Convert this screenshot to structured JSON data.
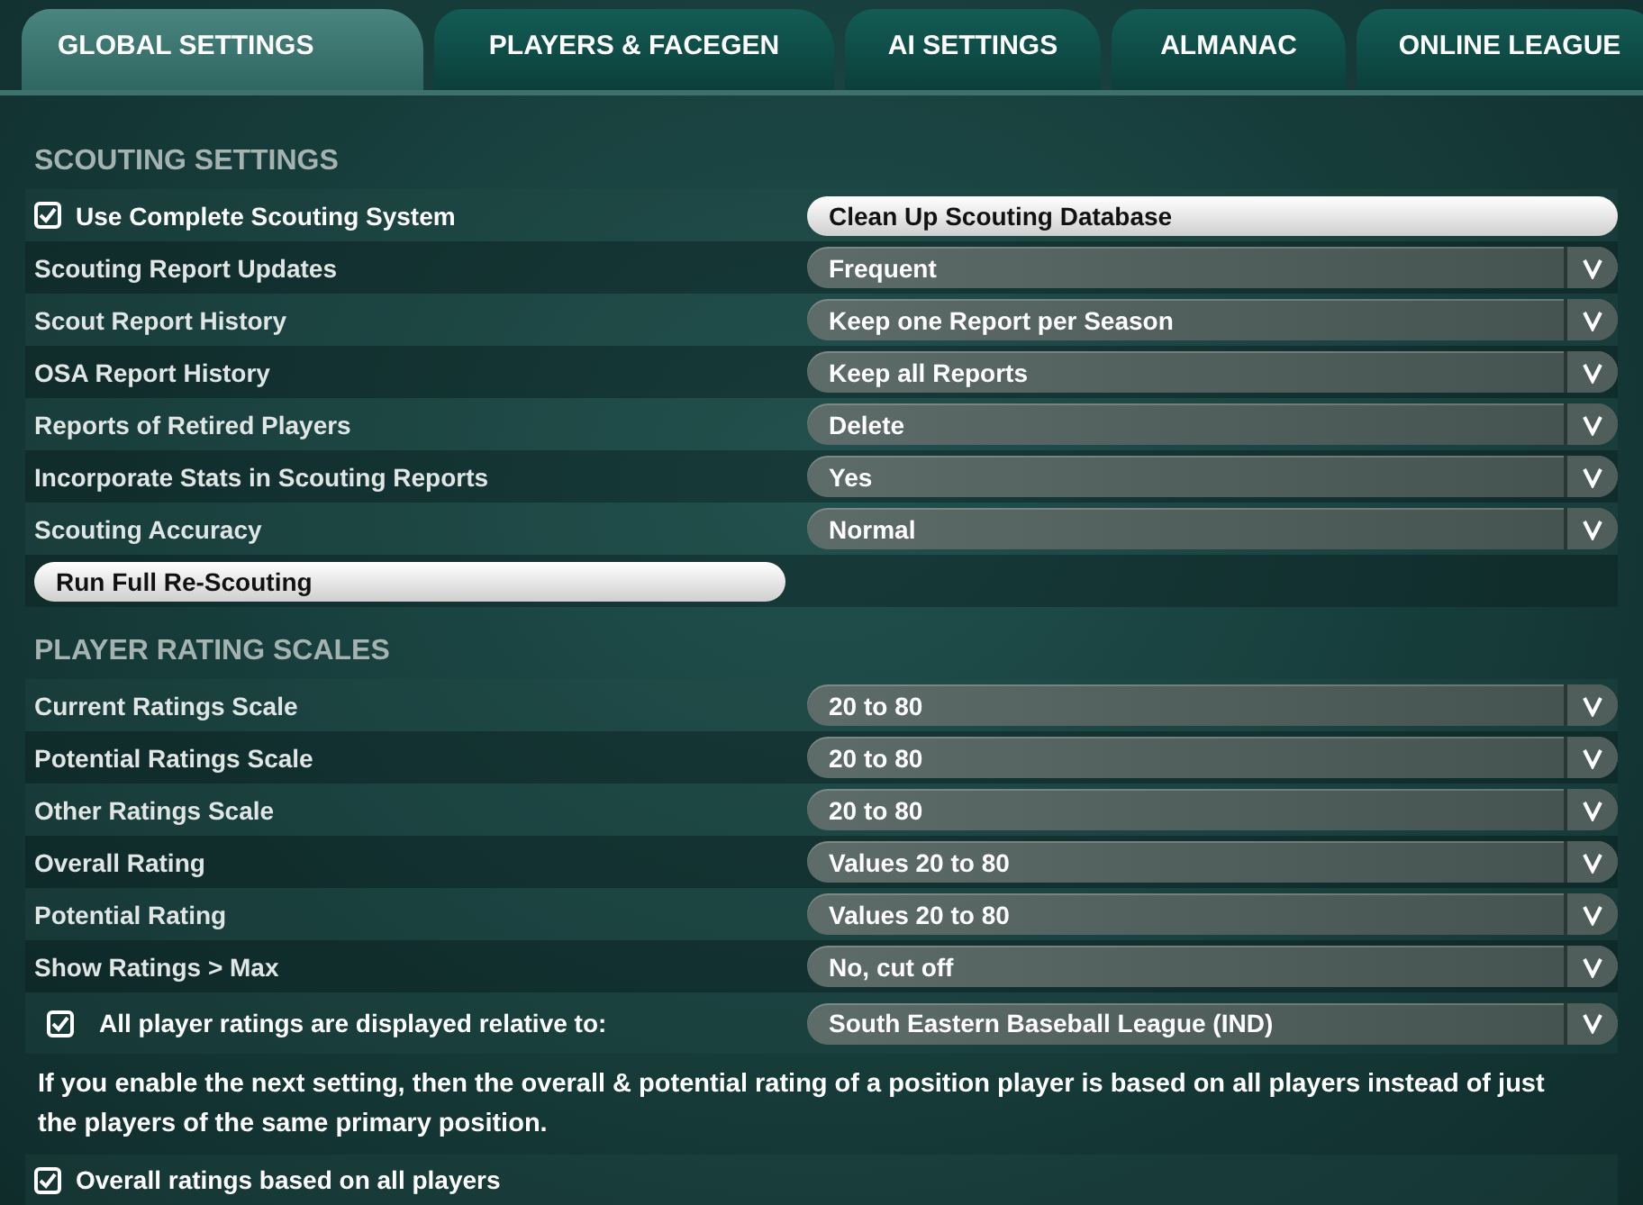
{
  "tabs": [
    {
      "label": "GLOBAL SETTINGS",
      "selected": true
    },
    {
      "label": "PLAYERS & FACEGEN",
      "selected": false
    },
    {
      "label": "AI SETTINGS",
      "selected": false
    },
    {
      "label": "ALMANAC",
      "selected": false
    },
    {
      "label": "ONLINE LEAGUE",
      "selected": false
    }
  ],
  "sections": [
    {
      "title": "SCOUTING SETTINGS",
      "items": [
        {
          "kind": "checkbox_button",
          "label": "Use Complete Scouting System",
          "checked": true,
          "button": "Clean Up Scouting Database"
        },
        {
          "kind": "select",
          "label": "Scouting Report Updates",
          "value": "Frequent"
        },
        {
          "kind": "select",
          "label": "Scout Report History",
          "value": "Keep one Report per Season"
        },
        {
          "kind": "select",
          "label": "OSA Report History",
          "value": "Keep all Reports"
        },
        {
          "kind": "select",
          "label": "Reports of Retired Players",
          "value": "Delete"
        },
        {
          "kind": "select",
          "label": "Incorporate Stats in Scouting Reports",
          "value": "Yes"
        },
        {
          "kind": "select",
          "label": "Scouting Accuracy",
          "value": "Normal"
        },
        {
          "kind": "button",
          "button": "Run Full Re-Scouting"
        }
      ]
    },
    {
      "title": "PLAYER RATING SCALES",
      "items": [
        {
          "kind": "select",
          "label": "Current Ratings Scale",
          "value": "20 to 80"
        },
        {
          "kind": "select",
          "label": "Potential Ratings Scale",
          "value": "20 to 80"
        },
        {
          "kind": "select",
          "label": "Other Ratings Scale",
          "value": "20 to 80"
        },
        {
          "kind": "select",
          "label": "Overall Rating",
          "value": "Values 20 to 80"
        },
        {
          "kind": "select",
          "label": "Potential Rating",
          "value": "Values 20 to 80"
        },
        {
          "kind": "select",
          "label": "Show Ratings > Max",
          "value": "No, cut off"
        },
        {
          "kind": "checkbox_select",
          "label": "All player ratings are displayed relative to:",
          "checked": true,
          "value": "South Eastern Baseball League (IND)"
        },
        {
          "kind": "note",
          "text": "If you enable the next setting, then the overall & potential rating of a position player is based on all players instead of just the players of the same primary position."
        },
        {
          "kind": "checkbox",
          "label": "Overall ratings based on all players",
          "checked": true
        }
      ]
    }
  ]
}
